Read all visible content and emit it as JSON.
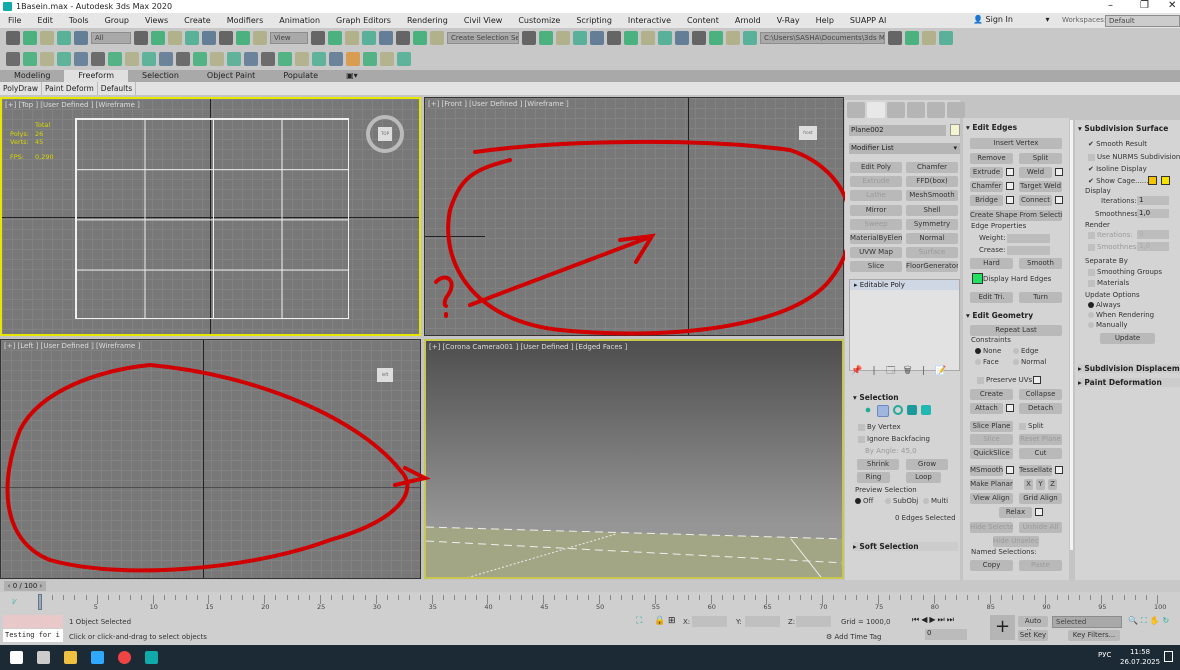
{
  "title": "1Basein.max - Autodesk 3ds Max 2020",
  "window_controls": {
    "minimize": "–",
    "restore": "❐",
    "close": "✕"
  },
  "menu": [
    "File",
    "Edit",
    "Tools",
    "Group",
    "Views",
    "Create",
    "Modifiers",
    "Animation",
    "Graph Editors",
    "Rendering",
    "Civil View",
    "Customize",
    "Scripting",
    "Interactive",
    "Content",
    "Arnold",
    "V-Ray",
    "Help",
    "SUAPP AI"
  ],
  "account": {
    "sign_in": "Sign In",
    "workspaces_label": "Workspaces:",
    "workspace": "Default"
  },
  "toolbar1": {
    "filter": "All",
    "ref_coord": "View",
    "selection_set": "Create Selection Se",
    "project_path": "C:\\Users\\SASHA\\Documents\\3ds Max 2020",
    "icons_left": [
      "undo-icon",
      "redo-icon",
      "link-icon",
      "unlink-icon",
      "bind-spacewarp-icon"
    ],
    "icons_mid": [
      "select-object-icon",
      "select-by-name-icon",
      "rect-selection-icon",
      "window-crossing-icon",
      "move-icon",
      "rotate-icon",
      "scale-icon",
      "placement-icon"
    ],
    "icons_mid2": [
      "pivot-icon",
      "manipulate-icon",
      "keyboard-shortcut-icon",
      "snap-3d-icon",
      "angle-snap-icon",
      "percent-snap-icon",
      "spinner-snap-icon",
      "edit-named-sel-icon"
    ],
    "icons_right": [
      "mirror-icon",
      "align-icon",
      "scene-explorer-icon",
      "layer-explorer-icon",
      "toggle-ribbon-icon",
      "curve-editor-icon",
      "dope-sheet-icon",
      "schematic-view-icon",
      "material-editor-icon",
      "render-setup-icon",
      "rendered-frame-icon",
      "render-icon",
      "render-iterative-icon",
      "a360-icon"
    ],
    "icons_far": [
      "project-folder-icon",
      "open-project-icon",
      "create-project-icon",
      "project-settings-icon"
    ]
  },
  "toolbar2": {
    "icons": [
      "camera-icon",
      "particle-icon",
      "light-icon",
      "gear-icon",
      "tree-icon",
      "plugin-icon",
      "window-icon",
      "phone-icon",
      "torus-icon",
      "material-icon",
      "chrome-icon",
      "bulb-icon",
      "viewport-icon",
      "render-window-icon",
      "vfb-icon",
      "teapot-icon",
      "help-icon",
      "grid-a-icon",
      "grid-b-icon",
      "grid-c-icon",
      "fp-icon",
      "forest-icon",
      "tools-icon",
      "list-icon"
    ]
  },
  "ribbon": {
    "tabs": [
      "Modeling",
      "Freeform",
      "Selection",
      "Object Paint",
      "Populate"
    ],
    "active": 1,
    "subtabs": [
      "PolyDraw",
      "Paint Deform",
      "Defaults"
    ]
  },
  "viewports": {
    "top": {
      "label": "[+] [Top ] [User Defined ] [Wireframe ]",
      "stats": {
        "total": "Total",
        "polys_label": "Polys:",
        "polys": "26",
        "verts_label": "Verts:",
        "verts": "45",
        "fps_label": "FPS:",
        "fps": "0,290"
      },
      "viewcube": "TOP"
    },
    "front": {
      "label": "[+] [Front ] [User Defined ] [Wireframe ]",
      "viewcube": "front"
    },
    "left": {
      "label": "[+] [Left ] [User Defined ] [Wireframe ]",
      "viewcube": "left"
    },
    "camera": {
      "label": "[+] [Corona Camera001 ] [User Defined ] [Edged Faces ]"
    }
  },
  "command_panel": {
    "tabs": [
      "create-tab-icon",
      "modify-tab-icon",
      "hierarchy-tab-icon",
      "motion-tab-icon",
      "display-tab-icon",
      "utilities-tab-icon"
    ],
    "active": 1,
    "object_name": "Plane002",
    "object_color": "#f4f4d0",
    "modifier_list": "Modifier List",
    "modifier_buttons": [
      [
        "Edit Poly",
        "Chamfer"
      ],
      [
        "Extrude",
        "FFD(box)"
      ],
      [
        "Lathe",
        "MeshSmooth"
      ],
      [
        "Mirror",
        "Shell"
      ],
      [
        "Sweep",
        "Symmetry"
      ],
      [
        "MaterialByElement",
        "Normal"
      ],
      [
        "UVW Map",
        "Surface"
      ],
      [
        "Slice",
        "FloorGenerator"
      ]
    ],
    "stack_item": "Editable Poly",
    "selection": {
      "title": "Selection",
      "by_vertex": "By Vertex",
      "ignore_backfacing": "Ignore Backfacing",
      "by_angle": "By Angle:",
      "angle": "45,0",
      "shrink": "Shrink",
      "grow": "Grow",
      "ring": "Ring",
      "loop": "Loop",
      "preview": "Preview Selection",
      "off": "Off",
      "subobj": "SubObj",
      "multi": "Multi",
      "status": "0 Edges Selected"
    },
    "soft_selection": "Soft Selection"
  },
  "edit_edges": {
    "title": "Edit Edges",
    "insert_vertex": "Insert Vertex",
    "remove": "Remove",
    "split": "Split",
    "extrude": "Extrude",
    "weld": "Weld",
    "chamfer": "Chamfer",
    "target_weld": "Target Weld",
    "bridge": "Bridge",
    "connect": "Connect",
    "create_shape": "Create Shape From Selection",
    "edge_props": "Edge Properties",
    "weight": "Weight:",
    "crease": "Crease:",
    "hard": "Hard",
    "smooth": "Smooth",
    "display_hard": "Display Hard Edges",
    "hard_color": "#22e060",
    "edit_tri": "Edit Tri.",
    "turn": "Turn"
  },
  "edit_geometry": {
    "title": "Edit Geometry",
    "repeat_last": "Repeat Last",
    "constraints": "Constraints",
    "none": "None",
    "edge": "Edge",
    "face": "Face",
    "normal": "Normal",
    "preserve_uvs": "Preserve UVs",
    "create": "Create",
    "collapse": "Collapse",
    "attach": "Attach",
    "detach": "Detach",
    "slice_plane": "Slice Plane",
    "split": "Split",
    "slice": "Slice",
    "reset_plane": "Reset Plane",
    "quickslice": "QuickSlice",
    "cut": "Cut",
    "msmooth": "MSmooth",
    "tessellate": "Tessellate",
    "make_planar": "Make Planar",
    "x": "X",
    "y": "Y",
    "z": "Z",
    "view_align": "View Align",
    "grid_align": "Grid Align",
    "relax": "Relax",
    "hide_selected": "Hide Selected",
    "unhide_all": "Unhide All",
    "hide_unselected": "Hide Unselected",
    "named_sel": "Named Selections:",
    "copy": "Copy",
    "paste": "Paste"
  },
  "subdivision": {
    "title": "Subdivision Surface",
    "smooth_result": "Smooth Result",
    "use_nurms": "Use NURMS Subdivision",
    "isoline": "Isoline Display",
    "show_cage": "Show Cage......",
    "cage_colors": [
      "#f5c400",
      "#f5e000"
    ],
    "display": "Display",
    "iterations": "Iterations:",
    "iter_val": "1",
    "smoothness": "Smoothness:",
    "smooth_val": "1,0",
    "render": "Render",
    "r_iter_val": "0",
    "r_smooth_val": "1,0",
    "separate_by": "Separate By",
    "smoothing_groups": "Smoothing Groups",
    "materials": "Materials",
    "update_options": "Update Options",
    "always": "Always",
    "when_rendering": "When Rendering",
    "manually": "Manually",
    "update": "Update"
  },
  "rollouts_collapsed": [
    "Subdivision Displacemer",
    "Paint Deformation"
  ],
  "time": {
    "slider": "0 / 100",
    "ticks": [
      "0",
      "5",
      "10",
      "15",
      "20",
      "25",
      "30",
      "35",
      "40",
      "45",
      "50",
      "55",
      "60",
      "65",
      "70",
      "75",
      "80",
      "85",
      "90",
      "95",
      "100"
    ]
  },
  "status": {
    "maxscript": "Testing for i",
    "selected": "1 Object Selected",
    "prompt": "Click or click-and-drag to select objects",
    "x": "X:",
    "y": "Y:",
    "z": "Z:",
    "grid": "Grid = 1000,0",
    "add_time_tag": "Add Time Tag",
    "frame": "0",
    "auto_key": "Auto Key",
    "set_key": "Set Key",
    "key_mode": "Selected",
    "key_filters": "Key Filters..."
  },
  "taskbar": {
    "lang": "РУС",
    "time": "11:58",
    "date": "26.07.2025",
    "apps": [
      "windows-start-icon",
      "task-view-icon",
      "file-explorer-icon",
      "photoshop-icon",
      "chrome-icon",
      "3dsmax-icon"
    ]
  },
  "annotation_color": "#d00000"
}
